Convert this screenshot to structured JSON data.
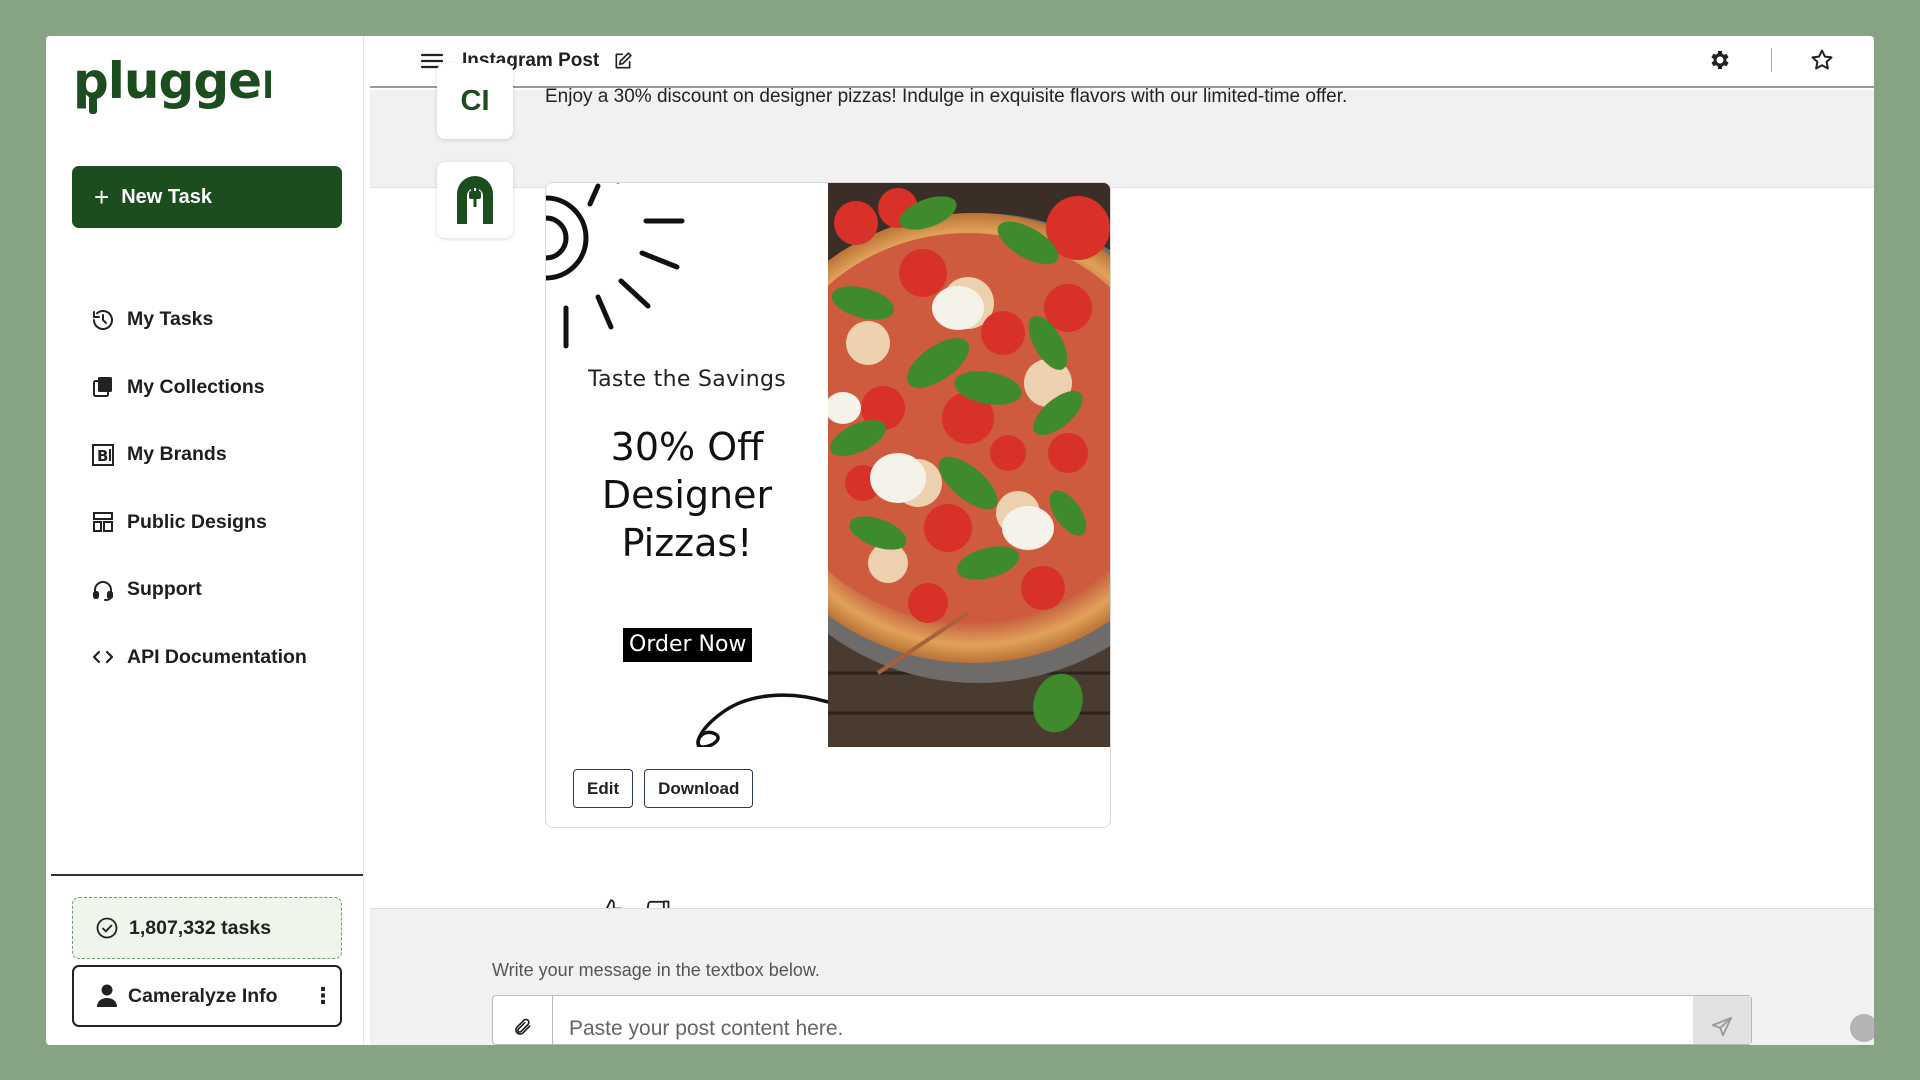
{
  "brand": {
    "logo_text": "plugger",
    "accent_color": "#1b4d1e"
  },
  "sidebar": {
    "new_task_label": "New Task",
    "items": [
      {
        "label": "My Tasks",
        "icon": "history-icon"
      },
      {
        "label": "My Collections",
        "icon": "collections-icon"
      },
      {
        "label": "My Brands",
        "icon": "brand-icon"
      },
      {
        "label": "Public Designs",
        "icon": "templates-icon"
      },
      {
        "label": "Support",
        "icon": "headset-icon"
      },
      {
        "label": "API Documentation",
        "icon": "code-icon"
      }
    ],
    "tasks_count": "1,807,332 tasks",
    "user_name": "Cameralyze Info"
  },
  "topbar": {
    "title": "Instagram Post"
  },
  "chat": {
    "user_initials": "CI",
    "user_message": "Enjoy a 30% discount on designer pizzas! Indulge in exquisite flavors with our limited-time offer.",
    "design": {
      "tagline": "Taste the Savings",
      "headline_line1": "30% Off",
      "headline_line2": "Designer",
      "headline_line3": "Pizzas!",
      "cta": "Order Now"
    },
    "edit_label": "Edit",
    "download_label": "Download"
  },
  "composer": {
    "hint": "Write your message in the textbox below.",
    "placeholder": "Paste your post content here."
  }
}
